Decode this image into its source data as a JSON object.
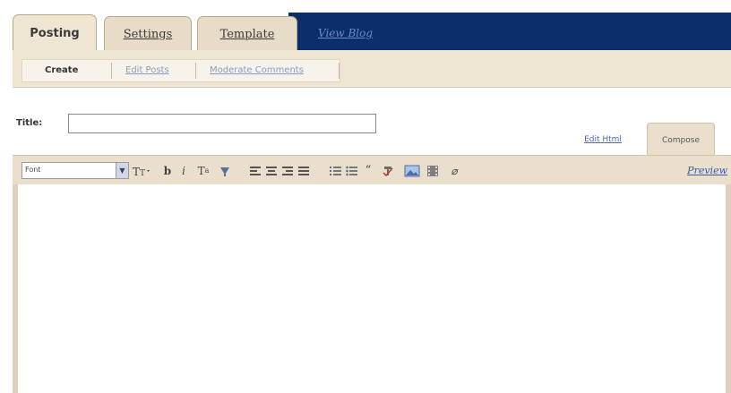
{
  "tabs": [
    {
      "label": "Posting",
      "active": true
    },
    {
      "label": "Settings",
      "active": false
    },
    {
      "label": "Template",
      "active": false
    }
  ],
  "view_blog": "View Blog",
  "subnav": {
    "create": "Create",
    "edit_posts": "Edit Posts",
    "moderate_comments": "Moderate Comments"
  },
  "title": {
    "label": "Title:",
    "value": ""
  },
  "modes": {
    "edit_html": "Edit Html",
    "compose": "Compose"
  },
  "toolbar": {
    "font_select": "Font",
    "preview": "Preview",
    "icons": [
      "text-size-icon",
      "bold-icon",
      "italic-icon",
      "text-color-icon",
      "link-icon",
      "align-left-icon",
      "align-center-icon",
      "align-right-icon",
      "justify-icon",
      "numbered-list-icon",
      "bullet-list-icon",
      "blockquote-icon",
      "spellcheck-icon",
      "image-icon",
      "video-icon",
      "remove-format-icon"
    ]
  },
  "colors": {
    "nav_blue": "#0a2f6b",
    "tab_beige": "#e7dcc8",
    "link_blue": "#3d5aa8"
  }
}
